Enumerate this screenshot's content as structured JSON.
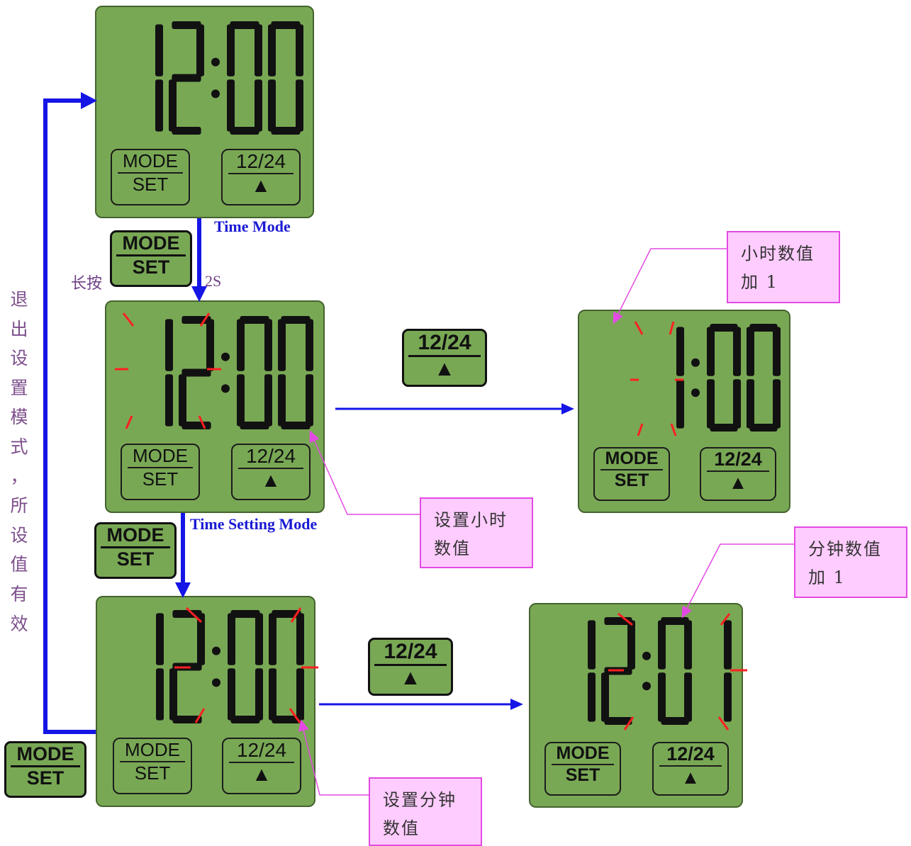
{
  "panels": [
    {
      "id": "time-mode",
      "time": "12:00",
      "mode_top": "MODE",
      "mode_bottom": "SET",
      "fmt_top": "12/24",
      "fmt_bottom": "▲"
    },
    {
      "id": "hour-setting",
      "time": "12:00",
      "mode_top": "MODE",
      "mode_bottom": "SET",
      "fmt_top": "12/24",
      "fmt_bottom": "▲"
    },
    {
      "id": "hour-plus-one",
      "time": "1:00",
      "mode_top": "MODE",
      "mode_bottom": "SET",
      "fmt_top": "12/24",
      "fmt_bottom": "▲"
    },
    {
      "id": "minute-setting",
      "time": "12:00",
      "mode_top": "MODE",
      "mode_bottom": "SET",
      "fmt_top": "12/24",
      "fmt_bottom": "▲"
    },
    {
      "id": "minute-plus-one",
      "time": "12:01",
      "mode_top": "MODE",
      "mode_bottom": "SET",
      "fmt_top": "12/24",
      "fmt_bottom": "▲"
    }
  ],
  "labels": {
    "time_mode": "Time Mode",
    "time_setting_mode": "Time Setting Mode",
    "long_press": "长按",
    "two_seconds": "2S",
    "exit_text": [
      "退",
      "出",
      "设",
      "置",
      "模",
      "式",
      "，",
      "所",
      "设",
      "值",
      "有",
      "效"
    ]
  },
  "buttons": {
    "mode_top": "MODE",
    "mode_bottom": "SET",
    "fmt_top": "12/24",
    "fmt_bottom": "▲"
  },
  "callouts": {
    "set_hour": [
      "设置小时",
      "数值"
    ],
    "hour_plus": [
      "小时数值",
      "加 1"
    ],
    "set_minute": [
      "设置分钟",
      "数值"
    ],
    "minute_plus": [
      "分钟数值",
      "加 1"
    ]
  },
  "colors": {
    "lcd": "#79a855",
    "arrow": "#1515e6",
    "callout": "#e34ae3",
    "blink": "#ff2020"
  }
}
